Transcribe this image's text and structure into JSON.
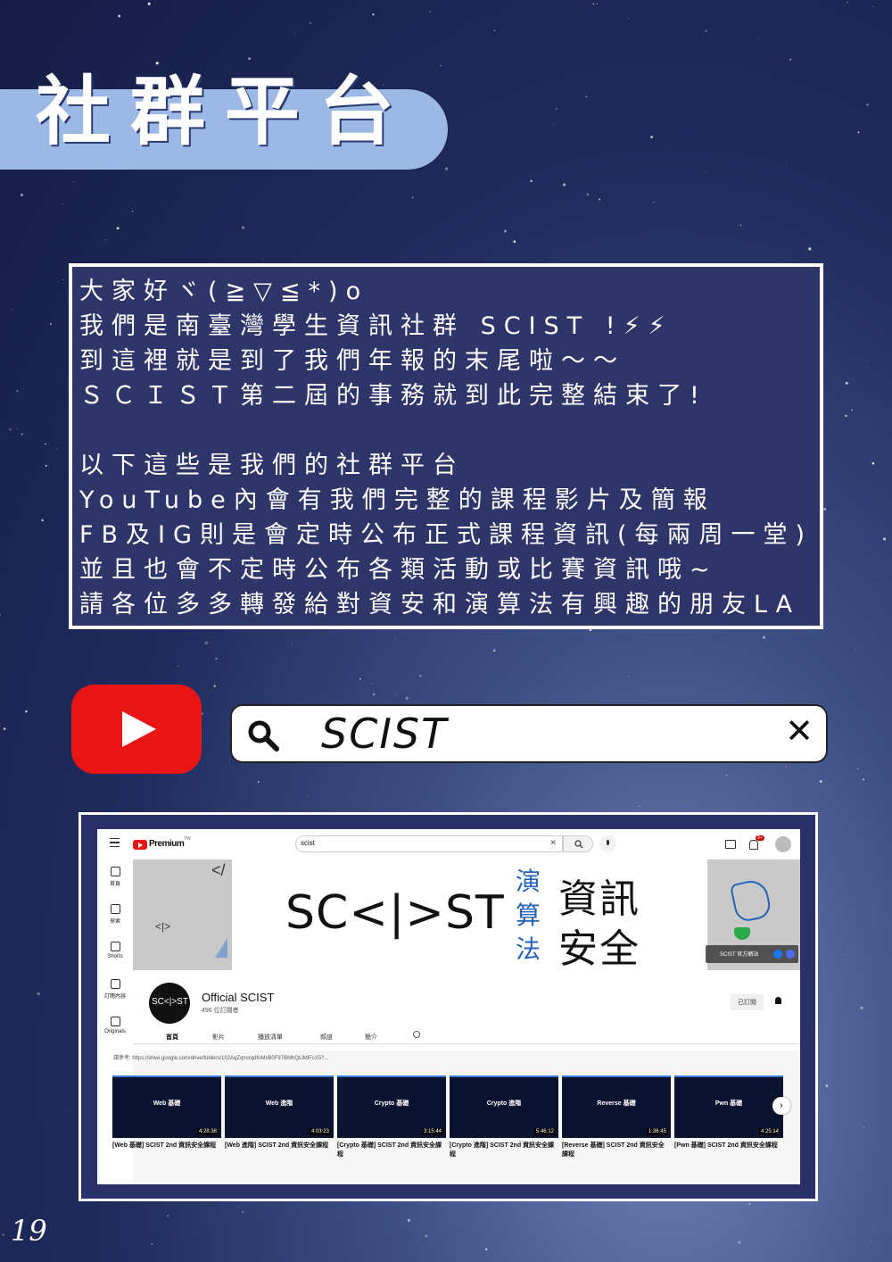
{
  "page": {
    "title": "社群平台",
    "page_number": "19"
  },
  "intro_lines": [
    "大家好ヾ(≧▽≦*)o",
    "我們是南臺灣學生資訊社群 SCIST !⚡⚡",
    "到這裡就是到了我們年報的末尾啦～～",
    "ＳＣＩＳＴ第二屆的事務就到此完整結束了!",
    "",
    "以下這些是我們的社群平台",
    "YouTube內會有我們完整的課程影片及簡報",
    "FB及IG則是會定時公布正式課程資訊(每兩周一堂)",
    "並且也會不定時公布各類活動或比賽資訊哦~",
    "請各位多多轉發給對資安和演算法有興趣的朋友LA"
  ],
  "search": {
    "query": "SCIST",
    "icon": "search-icon",
    "clear_icon": "close-icon"
  },
  "youtube": {
    "logo_text": "Premium",
    "region": "TW",
    "search_value": "scist",
    "notif_count": "9+",
    "sidebar": [
      "首頁",
      "探索",
      "Shorts",
      "訂閱內容",
      "Originals"
    ],
    "banner": {
      "logo": "SC<|>ST",
      "text_a": "演算法",
      "text_b1": "資訊",
      "text_b2": "安全",
      "link": "SCIST 官方網站"
    },
    "channel": {
      "avatar": "SC<|>ST",
      "name": "Official SCIST",
      "subs": "496 位訂閱者",
      "subscribed": "已訂閱"
    },
    "tabs": [
      "首頁",
      "影片",
      "播放清單",
      "頻道",
      "簡介"
    ],
    "note": "請參考: https://drive.google.com/drive/folders/102AqZqnsrqdfoMxB0F97BMhQLlMiFcX5?...",
    "videos": [
      {
        "thumb": "Web 基礎",
        "duration": "4:28:38",
        "title": "[Web 基礎] SCIST 2nd 資訊安全課程"
      },
      {
        "thumb": "Web 進階",
        "duration": "4:03:23",
        "title": "[Web 進階] SCIST 2nd 資訊安全課程"
      },
      {
        "thumb": "Crypto 基礎",
        "duration": "3:15:44",
        "title": "[Crypto 基礎] SCIST 2nd 資訊安全課程"
      },
      {
        "thumb": "Crypto 進階",
        "duration": "5:46:12",
        "title": "[Crypto 進階] SCIST 2nd 資訊安全課程"
      },
      {
        "thumb": "Reverse 基礎",
        "duration": "1:36:45",
        "title": "[Reverse 基礎] SCIST 2nd 資訊安全課程"
      },
      {
        "thumb": "Pwn 基礎",
        "duration": "4:25:14",
        "title": "[Pwn 基礎] SCIST 2nd 資訊安全課程"
      }
    ]
  },
  "colors": {
    "title_pill": "#9cb9e6",
    "textbox_bg": "#2e3568",
    "youtube_red": "#e91515"
  }
}
